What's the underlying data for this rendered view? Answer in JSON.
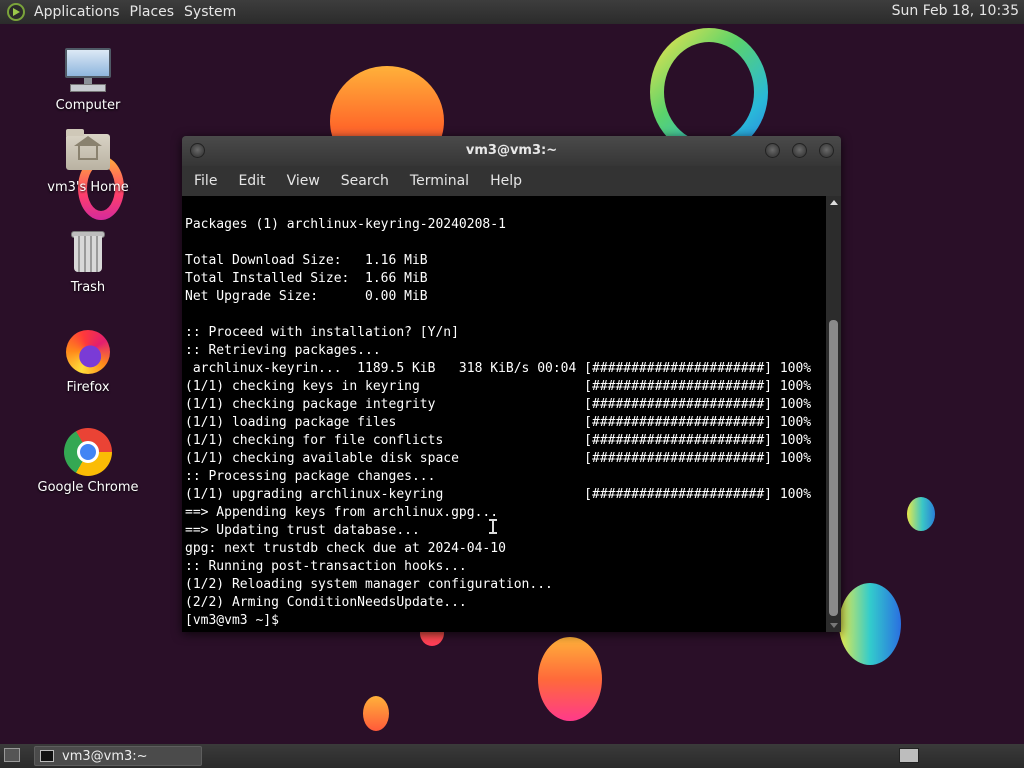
{
  "top_panel": {
    "menus": [
      "Applications",
      "Places",
      "System"
    ],
    "clock": "Sun Feb 18, 10:35"
  },
  "desktop_icons": [
    {
      "label": "Computer",
      "icon": "computer-icon"
    },
    {
      "label": "vm3's Home",
      "icon": "home-folder-icon"
    },
    {
      "label": "Trash",
      "icon": "trash-icon"
    },
    {
      "label": "Firefox",
      "icon": "firefox-icon"
    },
    {
      "label": "Google Chrome",
      "icon": "chrome-icon"
    }
  ],
  "terminal": {
    "title": "vm3@vm3:~",
    "menu": [
      "File",
      "Edit",
      "View",
      "Search",
      "Terminal",
      "Help"
    ],
    "output": "Packages (1) archlinux-keyring-20240208-1\n\nTotal Download Size:   1.16 MiB\nTotal Installed Size:  1.66 MiB\nNet Upgrade Size:      0.00 MiB\n\n:: Proceed with installation? [Y/n]\n:: Retrieving packages...\n archlinux-keyrin...  1189.5 KiB   318 KiB/s 00:04 [######################] 100%\n(1/1) checking keys in keyring                     [######################] 100%\n(1/1) checking package integrity                   [######################] 100%\n(1/1) loading package files                        [######################] 100%\n(1/1) checking for file conflicts                  [######################] 100%\n(1/1) checking available disk space                [######################] 100%\n:: Processing package changes...\n(1/1) upgrading archlinux-keyring                  [######################] 100%\n==> Appending keys from archlinux.gpg...\n==> Updating trust database...\ngpg: next trustdb check due at 2024-04-10\n:: Running post-transaction hooks...\n(1/2) Reloading system manager configuration...\n(2/2) Arming ConditionNeedsUpdate...\n[vm3@vm3 ~]$"
  },
  "taskbar": {
    "tasks": [
      {
        "label": "vm3@vm3:~",
        "icon": "terminal-icon"
      }
    ]
  },
  "colors": {
    "wallpaper": "#2a0f28",
    "terminal_bg": "#000000",
    "terminal_fg": "#ffffff",
    "panel": "#333333"
  }
}
